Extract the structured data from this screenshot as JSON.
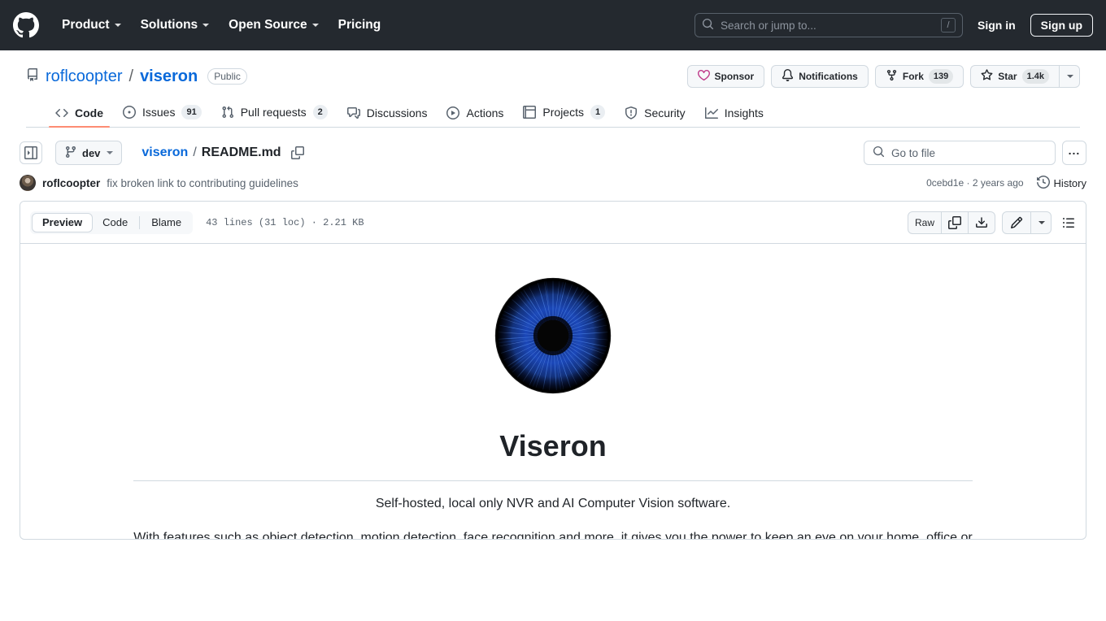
{
  "global_header": {
    "logo_icon": "github-mark-icon",
    "nav": [
      {
        "label": "Product",
        "has_caret": true
      },
      {
        "label": "Solutions",
        "has_caret": true
      },
      {
        "label": "Open Source",
        "has_caret": true
      },
      {
        "label": "Pricing",
        "has_caret": false
      }
    ],
    "search": {
      "placeholder": "Search or jump to...",
      "icon": "search-icon",
      "shortcut_key": "/"
    },
    "sign_in": "Sign in",
    "sign_up": "Sign up",
    "background_color": "#24292f"
  },
  "repo": {
    "icon": "repo-icon",
    "owner": "roflcoopter",
    "separator": "/",
    "name": "viseron",
    "visibility": "Public",
    "actions": [
      {
        "label": "Sponsor",
        "icon": "heart-icon",
        "count": null
      },
      {
        "label": "Notifications",
        "icon": "bell-icon",
        "count": null
      },
      {
        "label": "Fork",
        "icon": "fork-icon",
        "count": "139"
      },
      {
        "label": "Star",
        "icon": "star-icon",
        "count": "1.4k"
      }
    ],
    "star_caret_icon": "chevron-down-icon"
  },
  "repo_nav": {
    "tabs": [
      {
        "label": "Code",
        "icon": "code-icon",
        "count": null,
        "active": true
      },
      {
        "label": "Issues",
        "icon": "issue-opened-icon",
        "count": "91",
        "active": false
      },
      {
        "label": "Pull requests",
        "icon": "git-pull-request-icon",
        "count": "2",
        "active": false
      },
      {
        "label": "Discussions",
        "icon": "comment-discussion-icon",
        "count": null,
        "active": false
      },
      {
        "label": "Actions",
        "icon": "play-icon",
        "count": null,
        "active": false
      },
      {
        "label": "Projects",
        "icon": "table-icon",
        "count": "1",
        "active": false
      },
      {
        "label": "Security",
        "icon": "shield-icon",
        "count": null,
        "active": false
      },
      {
        "label": "Insights",
        "icon": "graph-icon",
        "count": null,
        "active": false
      }
    ],
    "active_underline_color": "#fd8c73"
  },
  "file_nav": {
    "sidebar_toggle_icon": "sidebar-expand-icon",
    "branch": "dev",
    "branch_icon": "git-branch-icon",
    "breadcrumb": {
      "root": "viseron",
      "separator": "/",
      "current": "README.md"
    },
    "copy_path_icon": "copy-icon",
    "go_to_file": {
      "placeholder": "Go to file",
      "icon": "search-icon"
    },
    "kebab_label": "...",
    "kebab_icon": "kebab-horizontal-icon"
  },
  "commit": {
    "avatar_icon": "avatar",
    "author": "roflcoopter",
    "message": "fix broken link to contributing guidelines",
    "sha": "0cebd1e",
    "dot": "·",
    "time": "2 years ago",
    "history_label": "History",
    "history_icon": "history-icon"
  },
  "file_toolbar": {
    "views": [
      {
        "label": "Preview",
        "active": true
      },
      {
        "label": "Code",
        "active": false
      },
      {
        "label": "Blame",
        "active": false
      }
    ],
    "stats": "43 lines (31 loc) · 2.21 KB",
    "raw_label": "Raw",
    "copy_icon": "copy-icon",
    "download_icon": "download-icon",
    "edit_icon": "pencil-icon",
    "edit_caret_icon": "chevron-down-icon",
    "outline_icon": "list-unordered-icon"
  },
  "readme": {
    "logo_alt": "viseron-eye-logo",
    "heading": "Viseron",
    "paragraph_1": "Self-hosted, local only NVR and AI Computer Vision software.",
    "paragraph_2": "With features such as object detection, motion detection, face recognition and more, it gives you the power to keep an eye on your home, office or any other place you want to monitor."
  },
  "colors": {
    "link": "#0969da",
    "muted": "#59636e",
    "border": "#d1d9e0",
    "canvas_subtle": "#f6f8fa",
    "accent_underline": "#fd8c73",
    "sponsor_pink": "#bf3989",
    "iris_blue": "#1b3a8f"
  }
}
